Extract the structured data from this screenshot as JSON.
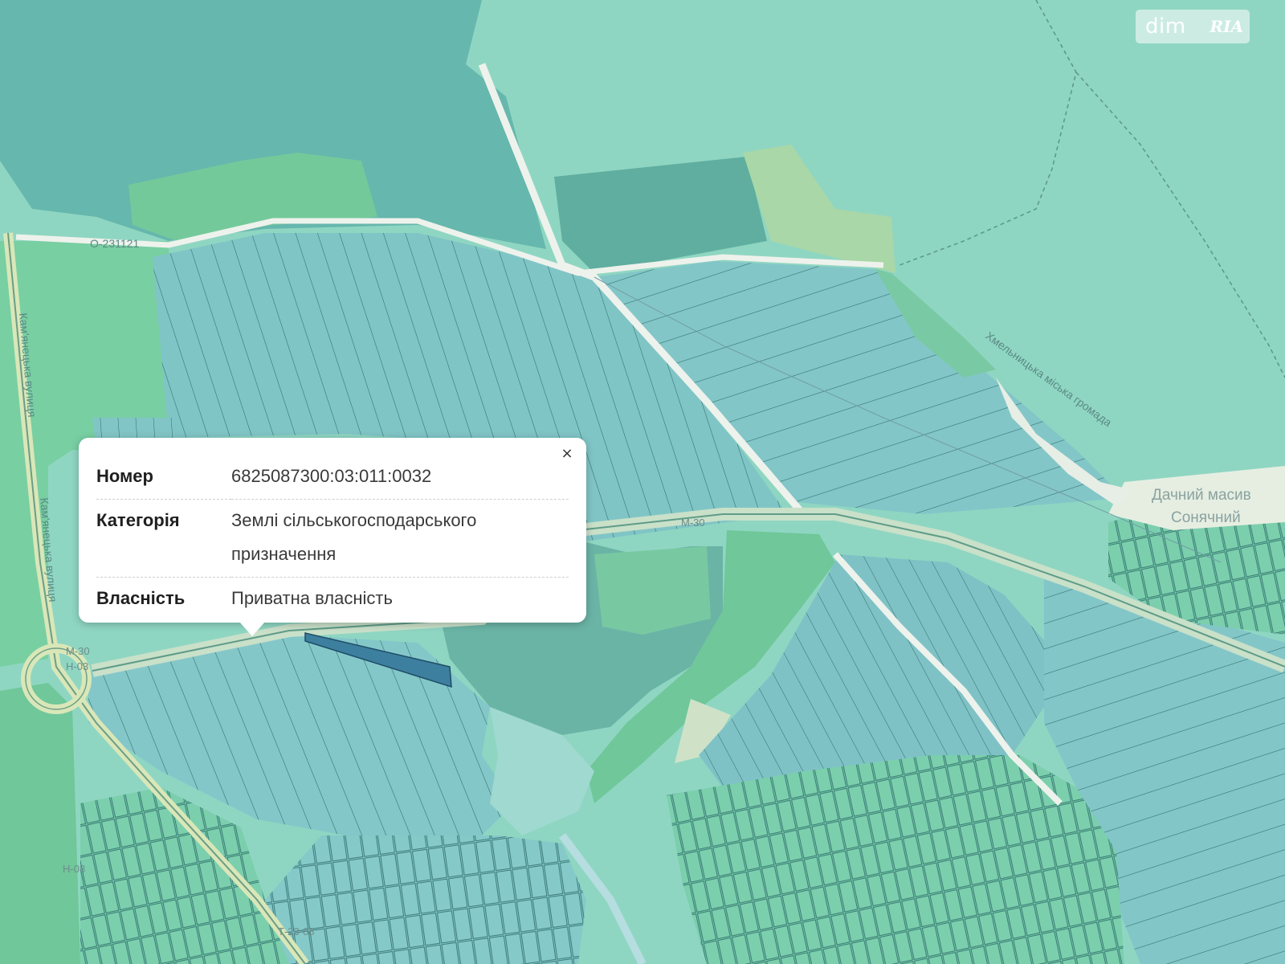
{
  "watermark": {
    "left_text": "dim",
    "right_text": "RIA"
  },
  "popup": {
    "close_symbol": "×",
    "rows": [
      {
        "label": "Номер",
        "value": "6825087300:03:011:0032"
      },
      {
        "label": "Категорія",
        "value": "Землі сільськогосподарського призначення"
      },
      {
        "label": "Власність",
        "value": "Приватна власність"
      }
    ]
  },
  "map_labels": {
    "road_o231121": "О-231121",
    "road_m30_a": "М-30",
    "road_m30_b": "М-30",
    "road_n03_a": "Н-03",
    "road_n03_b": "Н-03",
    "road_t2308": "Т-23-08",
    "street_kamianetska_1": "Кам'янецька вулиця",
    "street_kamianetska_2": "Кам'янецька вулиця",
    "community": "Хмельницька міська громада",
    "massif_line1": "Дачний масив",
    "massif_line2": "Сонячний"
  },
  "colors": {
    "background": "#8fd6c2",
    "forest": "#65b5ac",
    "parcel": "#7fc3c7",
    "parcel_line": "#2d6a6a",
    "green_area": "#6cc49a",
    "road": "#ecf1ea",
    "accent_parcel": "#3d7f9e"
  }
}
